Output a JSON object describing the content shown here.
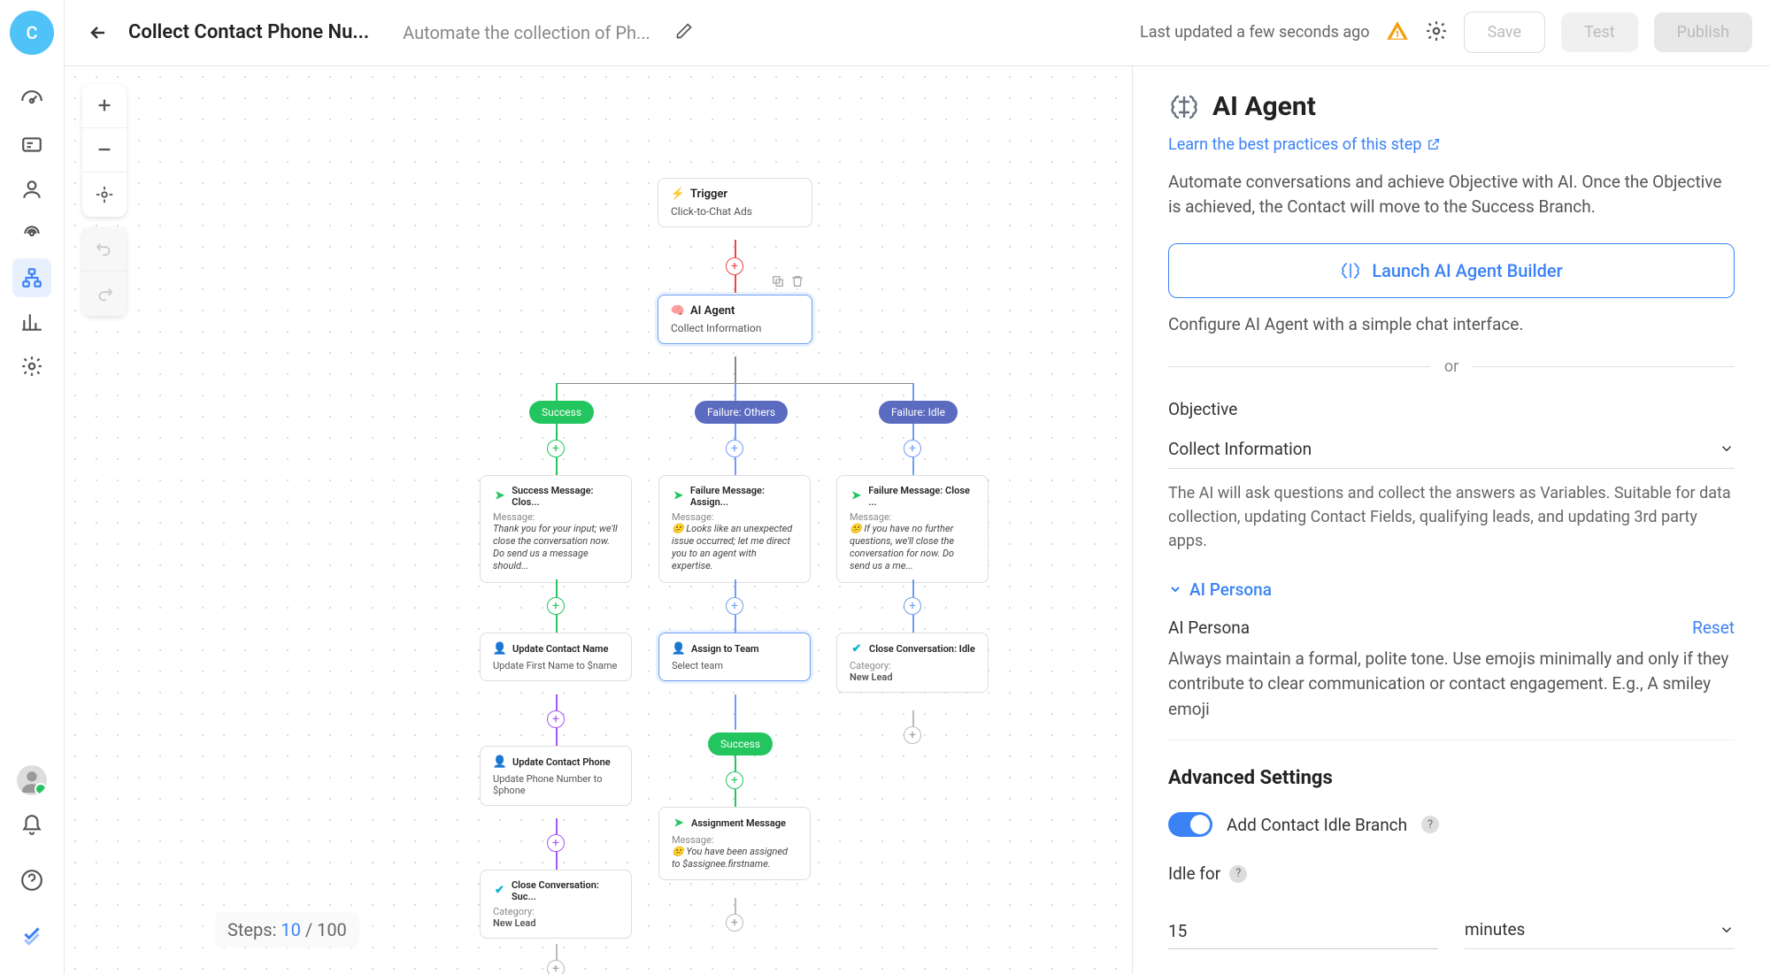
{
  "sidebar": {
    "avatar_letter": "C"
  },
  "header": {
    "title": "Collect Contact Phone Nu...",
    "subtitle": "Automate the collection of Ph...",
    "last_updated": "Last updated a few seconds ago",
    "save": "Save",
    "test": "Test",
    "publish": "Publish"
  },
  "canvas": {
    "steps_label": "Steps:",
    "steps_current": "10",
    "steps_sep": "/",
    "steps_max": "100",
    "nodes": {
      "trigger": {
        "title": "Trigger",
        "sub": "Click-to-Chat Ads"
      },
      "ai_agent": {
        "title": "AI Agent",
        "sub": "Collect Information"
      },
      "pill_success": "Success",
      "pill_failure_others": "Failure: Others",
      "pill_failure_idle": "Failure: Idle",
      "success_msg": {
        "title": "Success Message: Clos...",
        "label": "Message:",
        "body": "Thank you for your input; we'll close the conversation now. Do send us a message should..."
      },
      "failure_others_msg": {
        "title": "Failure Message: Assign...",
        "label": "Message:",
        "body": "😕 Looks like an unexpected issue occurred; let me direct you to an agent with expertise."
      },
      "failure_idle_msg": {
        "title": "Failure Message: Close ...",
        "label": "Message:",
        "body": "😕 If you have no further questions, we'll close the conversation for now. Do send us a me..."
      },
      "update_name": {
        "title": "Update Contact Name",
        "sub": "Update First Name to $name"
      },
      "assign_team": {
        "title": "Assign to Team",
        "sub": "Select team"
      },
      "close_idle": {
        "title": "Close Conversation: Idle",
        "label": "Category:",
        "cat": "New Lead"
      },
      "update_phone": {
        "title": "Update Contact Phone",
        "sub": "Update Phone Number to $phone"
      },
      "pill_success2": "Success",
      "assignment_msg": {
        "title": "Assignment Message",
        "label": "Message:",
        "body": "😕 You have been assigned to $assignee.firstname."
      },
      "close_success": {
        "title": "Close Conversation: Suc...",
        "label": "Category:",
        "cat": "New Lead"
      }
    }
  },
  "panel": {
    "title": "AI Agent",
    "learn_link": "Learn the best practices of this step",
    "desc": "Automate conversations and achieve Objective with AI. Once the Objective is achieved, the Contact will move to the Success Branch.",
    "launch": "Launch AI Agent Builder",
    "launch_desc": "Configure AI Agent with a simple chat interface.",
    "or": "or",
    "objective_label": "Objective",
    "objective_value": "Collect Information",
    "objective_help": "The AI will ask questions and collect the answers as Variables. Suitable for data collection, updating Contact Fields, qualifying leads, and updating 3rd party apps.",
    "persona_header": "AI Persona",
    "persona_label": "AI Persona",
    "reset": "Reset",
    "persona_text": "Always maintain a formal, polite tone. Use emojis minimally and only if they contribute to clear communication or contact engagement. E.g., A smiley emoji",
    "advanced": "Advanced Settings",
    "toggle_label": "Add Contact Idle Branch",
    "idle_label": "Idle for",
    "idle_value": "15",
    "idle_unit": "minutes"
  }
}
